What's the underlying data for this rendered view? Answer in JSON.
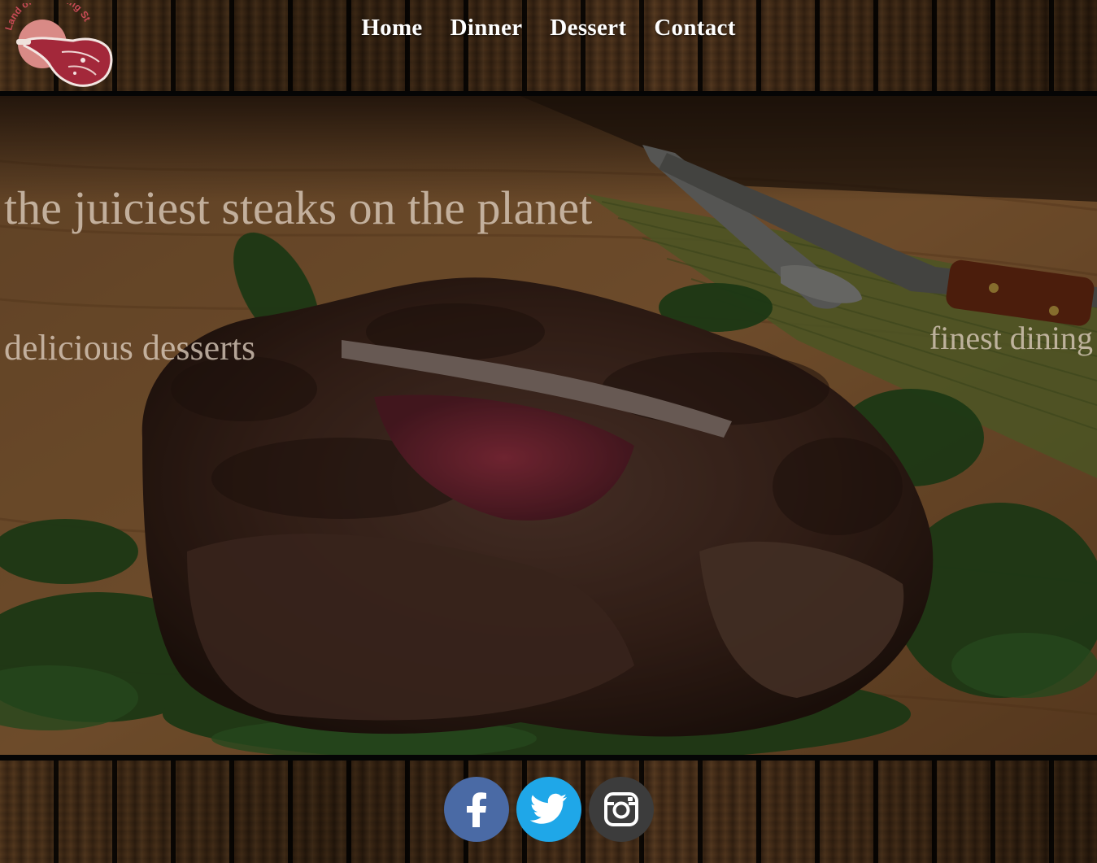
{
  "brand": {
    "logo_text": "Land of the Rising Steak",
    "accent": "#d98a86"
  },
  "nav": {
    "items": [
      "Home",
      "Dinner",
      "Dessert",
      "Contact"
    ]
  },
  "hero": {
    "taglines": [
      "the juiciest steaks on the planet",
      "delicious desserts",
      "finest dining"
    ]
  },
  "social": {
    "icons": [
      {
        "name": "facebook-icon",
        "color": "#4a6aa5"
      },
      {
        "name": "twitter-icon",
        "color": "#1fa7e8"
      },
      {
        "name": "instagram-icon",
        "color": "#3c3c3c"
      }
    ]
  }
}
